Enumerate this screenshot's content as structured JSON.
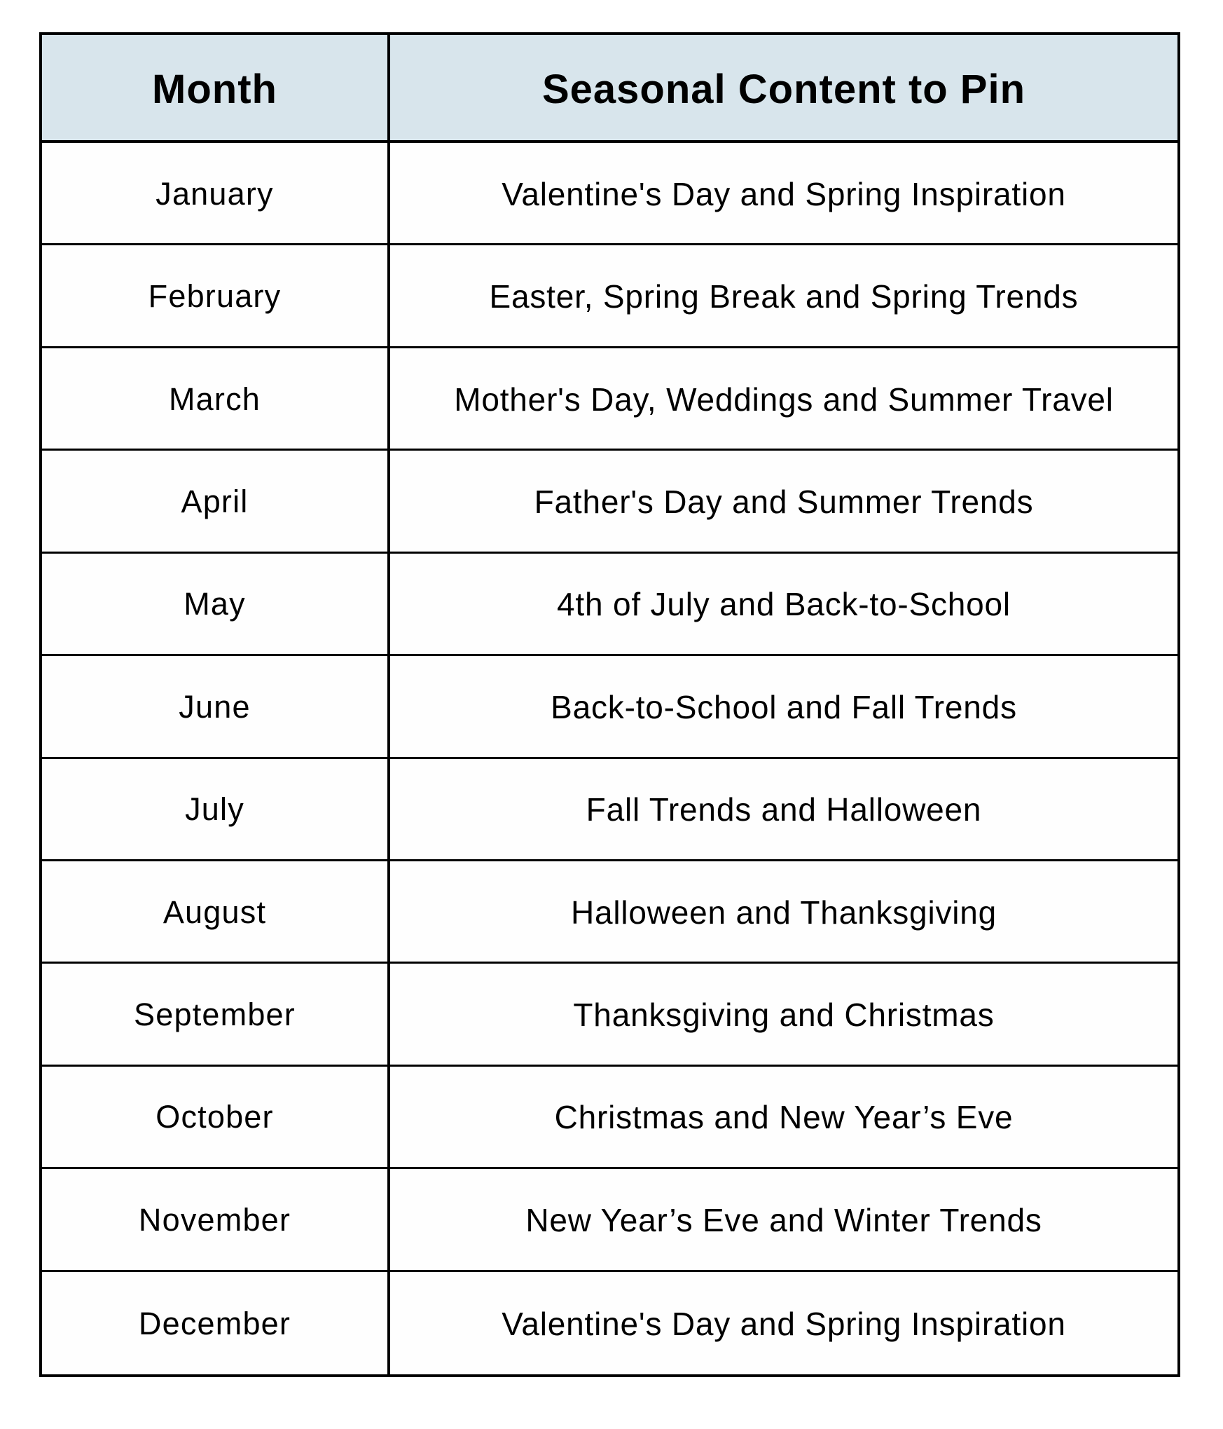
{
  "table": {
    "header": {
      "month": "Month",
      "content": "Seasonal Content to Pin"
    },
    "colors": {
      "header_background": "#d8e5ec",
      "border": "#000000",
      "text": "#000000"
    },
    "rows": [
      {
        "month": "January",
        "content": "Valentine's Day and Spring Inspiration"
      },
      {
        "month": "February",
        "content": "Easter, Spring Break and Spring Trends"
      },
      {
        "month": "March",
        "content": "Mother's Day, Weddings and Summer Travel"
      },
      {
        "month": "April",
        "content": "Father's Day and Summer Trends"
      },
      {
        "month": "May",
        "content": "4th of July and Back-to-School"
      },
      {
        "month": "June",
        "content": "Back-to-School and Fall Trends"
      },
      {
        "month": "July",
        "content": "Fall Trends and Halloween"
      },
      {
        "month": "August",
        "content": "Halloween and Thanksgiving"
      },
      {
        "month": "September",
        "content": "Thanksgiving and Christmas"
      },
      {
        "month": "October",
        "content": "Christmas and New Year’s Eve"
      },
      {
        "month": "November",
        "content": "New Year’s Eve and Winter Trends"
      },
      {
        "month": "December",
        "content": "Valentine's Day and Spring Inspiration"
      }
    ]
  }
}
